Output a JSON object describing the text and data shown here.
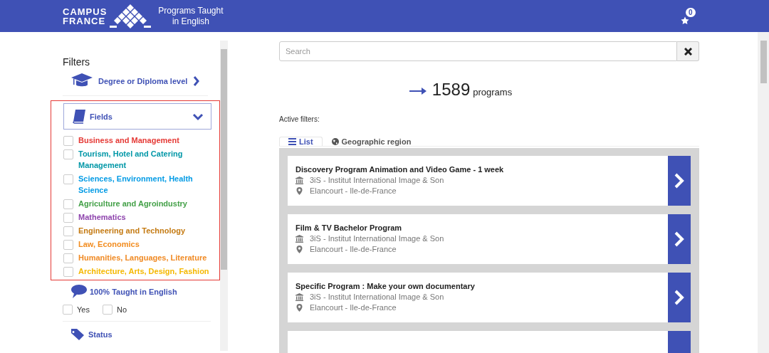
{
  "header": {
    "logo_line_1": "CAMPUS",
    "logo_line_2": "FRANCE",
    "tagline_line_1": "Programs Taught",
    "tagline_line_2": "in English",
    "favorites_count": "0"
  },
  "sidebar": {
    "title": "Filters",
    "degree_filter": {
      "label": "Degree or Diploma level",
      "expanded": false
    },
    "fields_filter": {
      "label": "Fields",
      "expanded": true,
      "highlighted": true,
      "items": [
        {
          "label": "Business and Management",
          "color": "#e53935",
          "checked": false
        },
        {
          "label": "Tourism, Hotel and Catering Management",
          "color": "#0097a7",
          "checked": false
        },
        {
          "label": "Sciences, Environment, Health Science",
          "color": "#039be5",
          "checked": false
        },
        {
          "label": "Agriculture and Agroindustry",
          "color": "#43a047",
          "checked": false
        },
        {
          "label": "Mathematics",
          "color": "#8e44ad",
          "checked": false
        },
        {
          "label": "Engineering and Technology",
          "color": "#c47a12",
          "checked": false
        },
        {
          "label": "Law, Economics",
          "color": "#f28c1f",
          "checked": false
        },
        {
          "label": "Humanities, Languages, Literature",
          "color": "#f08a24",
          "checked": false
        },
        {
          "label": "Architecture, Arts, Design, Fashion",
          "color": "#f5b800",
          "checked": false
        }
      ]
    },
    "english_filter": {
      "label": "100% Taught in English",
      "options": [
        {
          "label": "Yes",
          "checked": false
        },
        {
          "label": "No",
          "checked": false
        }
      ]
    },
    "status_filter": {
      "label": "Status"
    }
  },
  "search": {
    "placeholder": "Search"
  },
  "result": {
    "count": "1589",
    "unit": "programs"
  },
  "active_filters_label": "Active filters:",
  "tabs": [
    {
      "label": "List",
      "selected": true,
      "kind": "list"
    },
    {
      "label": "Geographic region",
      "selected": false,
      "kind": "globe"
    }
  ],
  "programs": [
    {
      "title": "Discovery Program Animation and Video Game - 1 week",
      "school": "3iS - Institut International Image & Son",
      "location": "Elancourt - Ile-de-France"
    },
    {
      "title": "Film & TV Bachelor Program",
      "school": "3iS - Institut International Image & Son",
      "location": "Elancourt - Ile-de-France"
    },
    {
      "title": "Specific Program : Make your own documentary",
      "school": "3iS - Institut International Image & Son",
      "location": "Elancourt - Ile-de-France"
    }
  ]
}
